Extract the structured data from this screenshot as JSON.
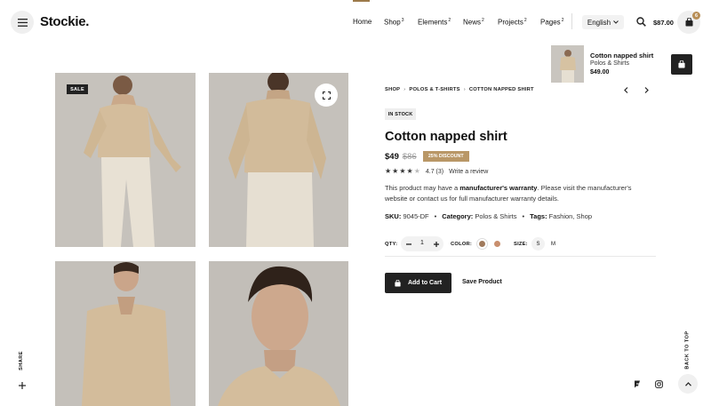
{
  "header": {
    "logo": "Stockie.",
    "nav": [
      {
        "label": "Home",
        "sup": ""
      },
      {
        "label": "Shop",
        "sup": "3"
      },
      {
        "label": "Elements",
        "sup": "2"
      },
      {
        "label": "News",
        "sup": "2"
      },
      {
        "label": "Projects",
        "sup": "2"
      },
      {
        "label": "Pages",
        "sup": "2"
      }
    ],
    "language": "English",
    "cart_total": "$87.00",
    "cart_count": "6"
  },
  "gallery": {
    "sale_label": "SALE"
  },
  "product": {
    "breadcrumb": [
      "SHOP",
      "POLOS & T-SHIRTS",
      "COTTON NAPPED SHIRT"
    ],
    "stock": "IN STOCK",
    "title": "Cotton napped shirt",
    "price": "$49",
    "old_price": "$86",
    "discount": "25% DISCOUNT",
    "rating": "4.7 (3)",
    "rating_value": 4.7,
    "review_link": "Write a review",
    "desc_pre": "This product may have a ",
    "desc_bold": "manufacturer's warranty",
    "desc_post": ". Please visit the manufacturer's website or contact us for full manufacturer warranty details.",
    "sku_label": "SKU:",
    "sku": "9045-DF",
    "category_label": "Category:",
    "category": "Polos & Shirts",
    "tags_label": "Tags:",
    "tags": "Fashion, Shop",
    "qty_label": "QTY:",
    "qty": "1",
    "color_label": "COLOR:",
    "colors": [
      "#a07a5c",
      "#c98f6e"
    ],
    "size_label": "SIZE:",
    "sizes": [
      "S",
      "M"
    ],
    "add_to_cart": "Add to Cart",
    "save": "Save Product"
  },
  "mini_cart": {
    "title": "Cotton napped shirt",
    "category": "Polos & Shirts",
    "price": "$49.00"
  },
  "side": {
    "share": "SHARE",
    "back_to_top": "BACK TO TOP"
  },
  "colors": {
    "accent": "#b99767",
    "dark": "#222222"
  }
}
